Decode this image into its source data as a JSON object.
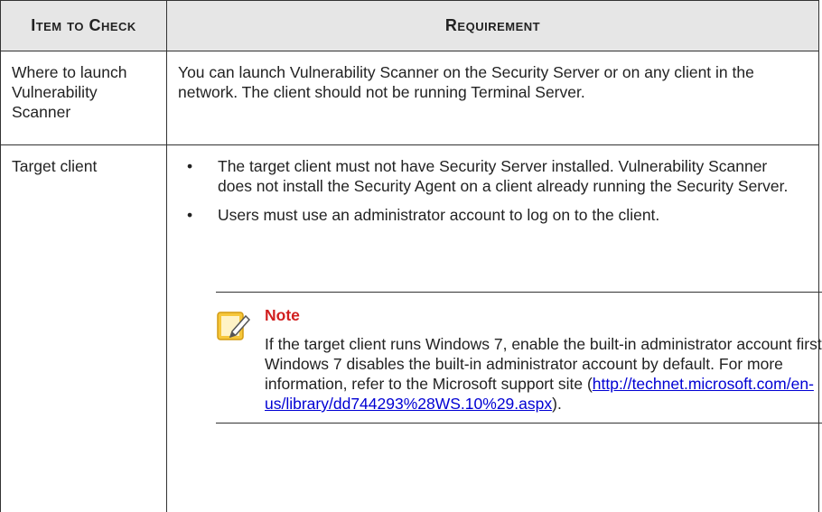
{
  "table": {
    "header": {
      "col1": "Item to Check",
      "col2": "Requirement"
    },
    "rows": [
      {
        "item": "Where to launch Vulnerability Scanner",
        "requirement": "You can launch Vulnerability Scanner on the Security Server or on any client in the network. The client should not be running Terminal Server."
      },
      {
        "item": "Target client",
        "bullets": [
          "The target client must not have Security Server installed. Vulnerability Scanner does not install the Security Agent on a client already running the Security Server.",
          "Users must use an administrator account to log on to the client."
        ],
        "note": {
          "title": "Note",
          "text_before_link": "If the target client runs Windows 7, enable the built-in administrator account first. Windows 7 disables the built-in administrator account by default. For more information, refer to the Microsoft support site (",
          "link": "http://technet.microsoft.com/en-us/library/dd744293%28WS.10%29.aspx",
          "text_after_link": ")."
        }
      }
    ]
  },
  "icons": {
    "note": "note-pencil-icon"
  },
  "colors": {
    "header_bg": "#e6e6e6",
    "note_title": "#d11f1f",
    "link": "#0000d4",
    "note_icon": "#f6c73b"
  }
}
